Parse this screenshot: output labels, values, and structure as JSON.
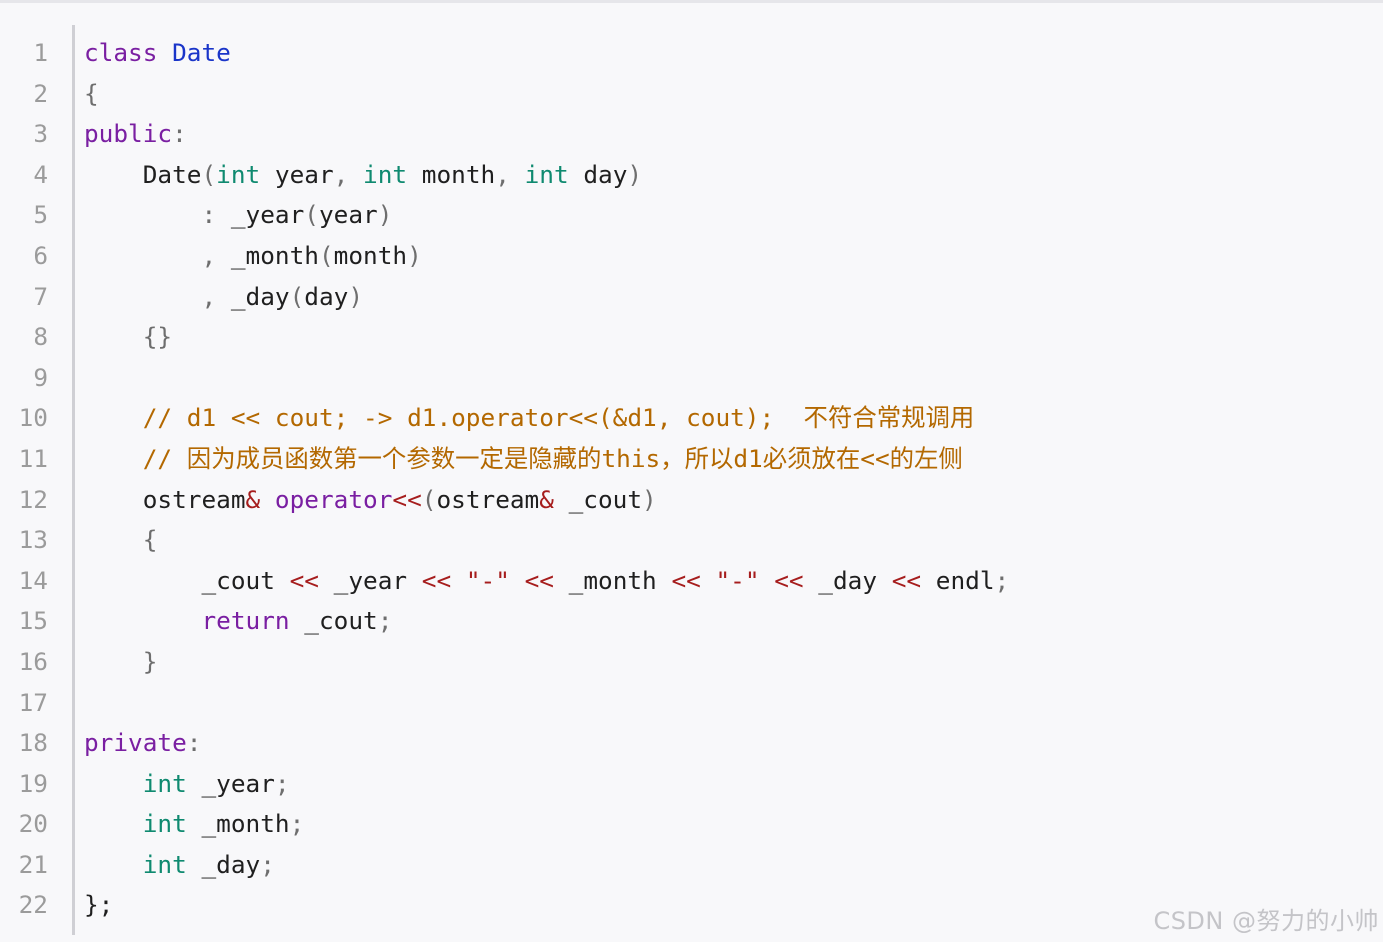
{
  "code": {
    "language": "cpp",
    "line_numbers": [
      "1",
      "2",
      "3",
      "4",
      "5",
      "6",
      "7",
      "8",
      "9",
      "10",
      "11",
      "12",
      "13",
      "14",
      "15",
      "16",
      "17",
      "18",
      "19",
      "20",
      "21",
      "22"
    ],
    "lines": [
      [
        {
          "t": "class",
          "c": "kw"
        },
        {
          "t": " "
        },
        {
          "t": "Date",
          "c": "cls"
        }
      ],
      [
        {
          "t": "{",
          "c": "pu"
        }
      ],
      [
        {
          "t": "public",
          "c": "kw"
        },
        {
          "t": ":",
          "c": "pu"
        }
      ],
      [
        {
          "t": "    Date"
        },
        {
          "t": "(",
          "c": "pu"
        },
        {
          "t": "int",
          "c": "ty"
        },
        {
          "t": " year"
        },
        {
          "t": ",",
          "c": "pu"
        },
        {
          "t": " "
        },
        {
          "t": "int",
          "c": "ty"
        },
        {
          "t": " month"
        },
        {
          "t": ",",
          "c": "pu"
        },
        {
          "t": " "
        },
        {
          "t": "int",
          "c": "ty"
        },
        {
          "t": " day"
        },
        {
          "t": ")",
          "c": "pu"
        }
      ],
      [
        {
          "t": "        "
        },
        {
          "t": ":",
          "c": "pu"
        },
        {
          "t": " _year"
        },
        {
          "t": "(",
          "c": "pu"
        },
        {
          "t": "year"
        },
        {
          "t": ")",
          "c": "pu"
        }
      ],
      [
        {
          "t": "        "
        },
        {
          "t": ",",
          "c": "pu"
        },
        {
          "t": " _month"
        },
        {
          "t": "(",
          "c": "pu"
        },
        {
          "t": "month"
        },
        {
          "t": ")",
          "c": "pu"
        }
      ],
      [
        {
          "t": "        "
        },
        {
          "t": ",",
          "c": "pu"
        },
        {
          "t": " _day"
        },
        {
          "t": "(",
          "c": "pu"
        },
        {
          "t": "day"
        },
        {
          "t": ")",
          "c": "pu"
        }
      ],
      [
        {
          "t": "    "
        },
        {
          "t": "{}",
          "c": "pu"
        }
      ],
      [
        {
          "t": ""
        }
      ],
      [
        {
          "t": "    "
        },
        {
          "t": "// d1 << cout; -> d1.operator<<(&d1, cout);  不符合常规调用",
          "c": "cm"
        }
      ],
      [
        {
          "t": "    "
        },
        {
          "t": "// 因为成员函数第一个参数一定是隐藏的this，所以d1必须放在<<的左侧",
          "c": "cm"
        }
      ],
      [
        {
          "t": "    ostream"
        },
        {
          "t": "&",
          "c": "op"
        },
        {
          "t": " "
        },
        {
          "t": "operator",
          "c": "fn"
        },
        {
          "t": "<<",
          "c": "op"
        },
        {
          "t": "(",
          "c": "pu"
        },
        {
          "t": "ostream"
        },
        {
          "t": "&",
          "c": "op"
        },
        {
          "t": " _cout"
        },
        {
          "t": ")",
          "c": "pu"
        }
      ],
      [
        {
          "t": "    "
        },
        {
          "t": "{",
          "c": "pu"
        }
      ],
      [
        {
          "t": "        _cout "
        },
        {
          "t": "<<",
          "c": "op"
        },
        {
          "t": " _year "
        },
        {
          "t": "<<",
          "c": "op"
        },
        {
          "t": " "
        },
        {
          "t": "\"-\"",
          "c": "str"
        },
        {
          "t": " "
        },
        {
          "t": "<<",
          "c": "op"
        },
        {
          "t": " _month "
        },
        {
          "t": "<<",
          "c": "op"
        },
        {
          "t": " "
        },
        {
          "t": "\"-\"",
          "c": "str"
        },
        {
          "t": " "
        },
        {
          "t": "<<",
          "c": "op"
        },
        {
          "t": " _day "
        },
        {
          "t": "<<",
          "c": "op"
        },
        {
          "t": " endl"
        },
        {
          "t": ";",
          "c": "pu"
        }
      ],
      [
        {
          "t": "        "
        },
        {
          "t": "return",
          "c": "kw"
        },
        {
          "t": " _cout"
        },
        {
          "t": ";",
          "c": "pu"
        }
      ],
      [
        {
          "t": "    "
        },
        {
          "t": "}",
          "c": "pu"
        }
      ],
      [
        {
          "t": ""
        }
      ],
      [
        {
          "t": "private",
          "c": "kw"
        },
        {
          "t": ":",
          "c": "pu"
        }
      ],
      [
        {
          "t": "    "
        },
        {
          "t": "int",
          "c": "ty"
        },
        {
          "t": " _year"
        },
        {
          "t": ";",
          "c": "pu"
        }
      ],
      [
        {
          "t": "    "
        },
        {
          "t": "int",
          "c": "ty"
        },
        {
          "t": " _month"
        },
        {
          "t": ";",
          "c": "pu"
        }
      ],
      [
        {
          "t": "    "
        },
        {
          "t": "int",
          "c": "ty"
        },
        {
          "t": " _day"
        },
        {
          "t": ";",
          "c": "pu"
        }
      ],
      [
        {
          "t": "};"
        }
      ]
    ]
  },
  "colors": {
    "keyword": "#7a1fa2",
    "type": "#0f8a70",
    "class_name": "#1a35c9",
    "comment": "#b36800",
    "operator": "#a61d1d",
    "punctuation": "#6e6e6e",
    "background": "#f8f8fa",
    "line_number": "#9b9b9b"
  },
  "watermark": "CSDN @努力的小帅"
}
